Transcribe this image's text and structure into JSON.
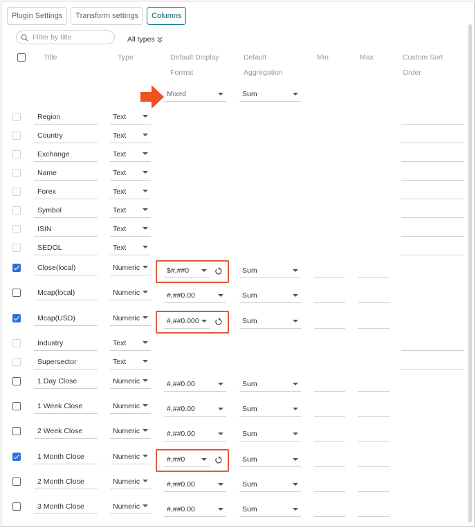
{
  "tabs": [
    {
      "label": "Plugin Settings",
      "active": false
    },
    {
      "label": "Transform settings",
      "active": false
    },
    {
      "label": "Columns",
      "active": true
    }
  ],
  "filter": {
    "placeholder": "Filter by title",
    "types_label": "All types"
  },
  "headers": {
    "title": "Title",
    "type": "Type",
    "format_line1": "Default Display",
    "format_line2": "Format",
    "agg_line1": "Default",
    "agg_line2": "Aggregation",
    "min": "Min",
    "max": "Max",
    "sort_line1": "Custom Sort",
    "sort_line2": "Order"
  },
  "bulk": {
    "format": "Mixed",
    "aggregation": "Sum"
  },
  "accent_color": "#e05a3a",
  "check_color": "#2f6fd8",
  "rows": [
    {
      "title": "Region",
      "type": "Text",
      "kind": "text",
      "checked": false
    },
    {
      "title": "Country",
      "type": "Text",
      "kind": "text",
      "checked": false
    },
    {
      "title": "Exchange",
      "type": "Text",
      "kind": "text",
      "checked": false
    },
    {
      "title": "Name",
      "type": "Text",
      "kind": "text",
      "checked": false
    },
    {
      "title": "Forex",
      "type": "Text",
      "kind": "text",
      "checked": false
    },
    {
      "title": "Symbol",
      "type": "Text",
      "kind": "text",
      "checked": false
    },
    {
      "title": "ISIN",
      "type": "Text",
      "kind": "text",
      "checked": false
    },
    {
      "title": "SEDOL",
      "type": "Text",
      "kind": "text",
      "checked": false
    },
    {
      "title": "Close(local)",
      "type": "Numeric",
      "kind": "num",
      "checked": true,
      "format": "$#,##0",
      "aggregation": "Sum",
      "highlight": true
    },
    {
      "title": "Mcap(local)",
      "type": "Numeric",
      "kind": "num",
      "checked": false,
      "format": "#,##0.00",
      "aggregation": "Sum",
      "highlight": false
    },
    {
      "title": "Mcap(USD)",
      "type": "Numeric",
      "kind": "num",
      "checked": true,
      "format": "#,##0.000",
      "aggregation": "Sum",
      "highlight": true
    },
    {
      "title": "Industry",
      "type": "Text",
      "kind": "text",
      "checked": false
    },
    {
      "title": "Supersector",
      "type": "Text",
      "kind": "text",
      "checked": false
    },
    {
      "title": "1 Day Close",
      "type": "Numeric",
      "kind": "num",
      "checked": false,
      "format": "#,##0.00",
      "aggregation": "Sum",
      "highlight": false
    },
    {
      "title": "1 Week Close",
      "type": "Numeric",
      "kind": "num",
      "checked": false,
      "format": "#,##0.00",
      "aggregation": "Sum",
      "highlight": false
    },
    {
      "title": "2 Week Close",
      "type": "Numeric",
      "kind": "num",
      "checked": false,
      "format": "#,##0.00",
      "aggregation": "Sum",
      "highlight": false
    },
    {
      "title": "1 Month Close",
      "type": "Numeric",
      "kind": "num",
      "checked": true,
      "format": "#,##0",
      "aggregation": "Sum",
      "highlight": true
    },
    {
      "title": "2 Month Close",
      "type": "Numeric",
      "kind": "num",
      "checked": false,
      "format": "#,##0.00",
      "aggregation": "Sum",
      "highlight": false
    },
    {
      "title": "3 Month Close",
      "type": "Numeric",
      "kind": "num",
      "checked": false,
      "format": "#,##0.00",
      "aggregation": "Sum",
      "highlight": false
    }
  ]
}
